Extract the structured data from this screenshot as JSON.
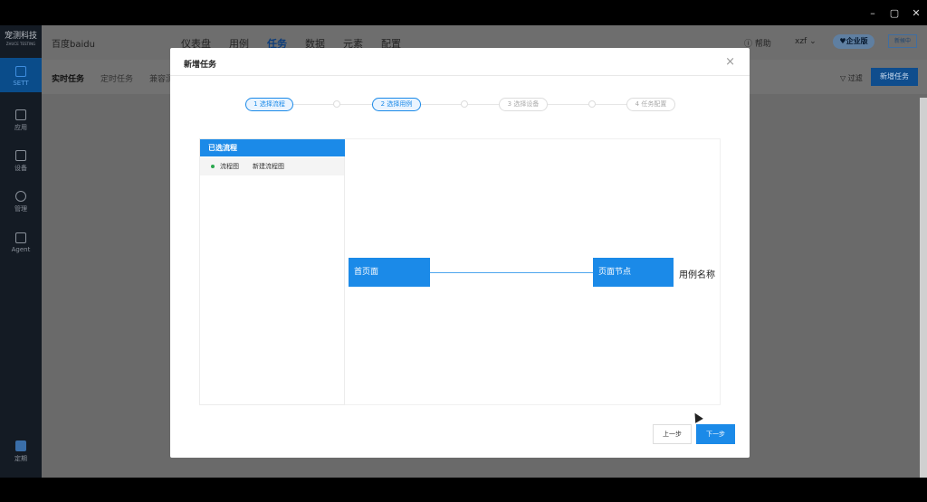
{
  "window": {
    "minimize": "–",
    "restore": "▢",
    "close": "✕"
  },
  "sidebar": {
    "logo": "宠测科技",
    "logo_sub": "ZHUCE TESTING",
    "items": [
      {
        "label": "SETT",
        "icon": "grid-icon"
      },
      {
        "label": "应用",
        "icon": "cube-icon"
      },
      {
        "label": "设备",
        "icon": "monitor-icon"
      },
      {
        "label": "管理",
        "icon": "gear-icon"
      },
      {
        "label": "Agent",
        "icon": "agent-icon"
      },
      {
        "label": "定期",
        "icon": "building-icon"
      }
    ]
  },
  "topnav": {
    "project": "百度baidu",
    "menu": [
      "仪表盘",
      "用例",
      "任务",
      "数据",
      "元素",
      "配置"
    ],
    "help": "ⓘ 帮助",
    "user": "xzf ⌄",
    "edition": "♥企业版",
    "upgrade": "新候中"
  },
  "subnav": {
    "tabs": [
      "实时任务",
      "定时任务",
      "兼容测"
    ],
    "filter": "▽ 过滤",
    "new_task": "新增任务"
  },
  "modal": {
    "title": "新增任务",
    "close": "×",
    "steps": [
      "1 选择流程",
      "2 选择用例",
      "3 选择设备",
      "4 任务配置"
    ],
    "flow_header": "已选流程",
    "flow_row": {
      "name": "流程图",
      "sub": "新建流程图"
    },
    "nodes": [
      {
        "label": "首页面"
      },
      {
        "label": "页面节点"
      }
    ],
    "node_caption": "用例名称",
    "prev": "上一步",
    "next": "下一步"
  },
  "colors": {
    "accent": "#1b8ae8",
    "sidebar": "#141b24",
    "overlay": "#6e6e6e"
  }
}
